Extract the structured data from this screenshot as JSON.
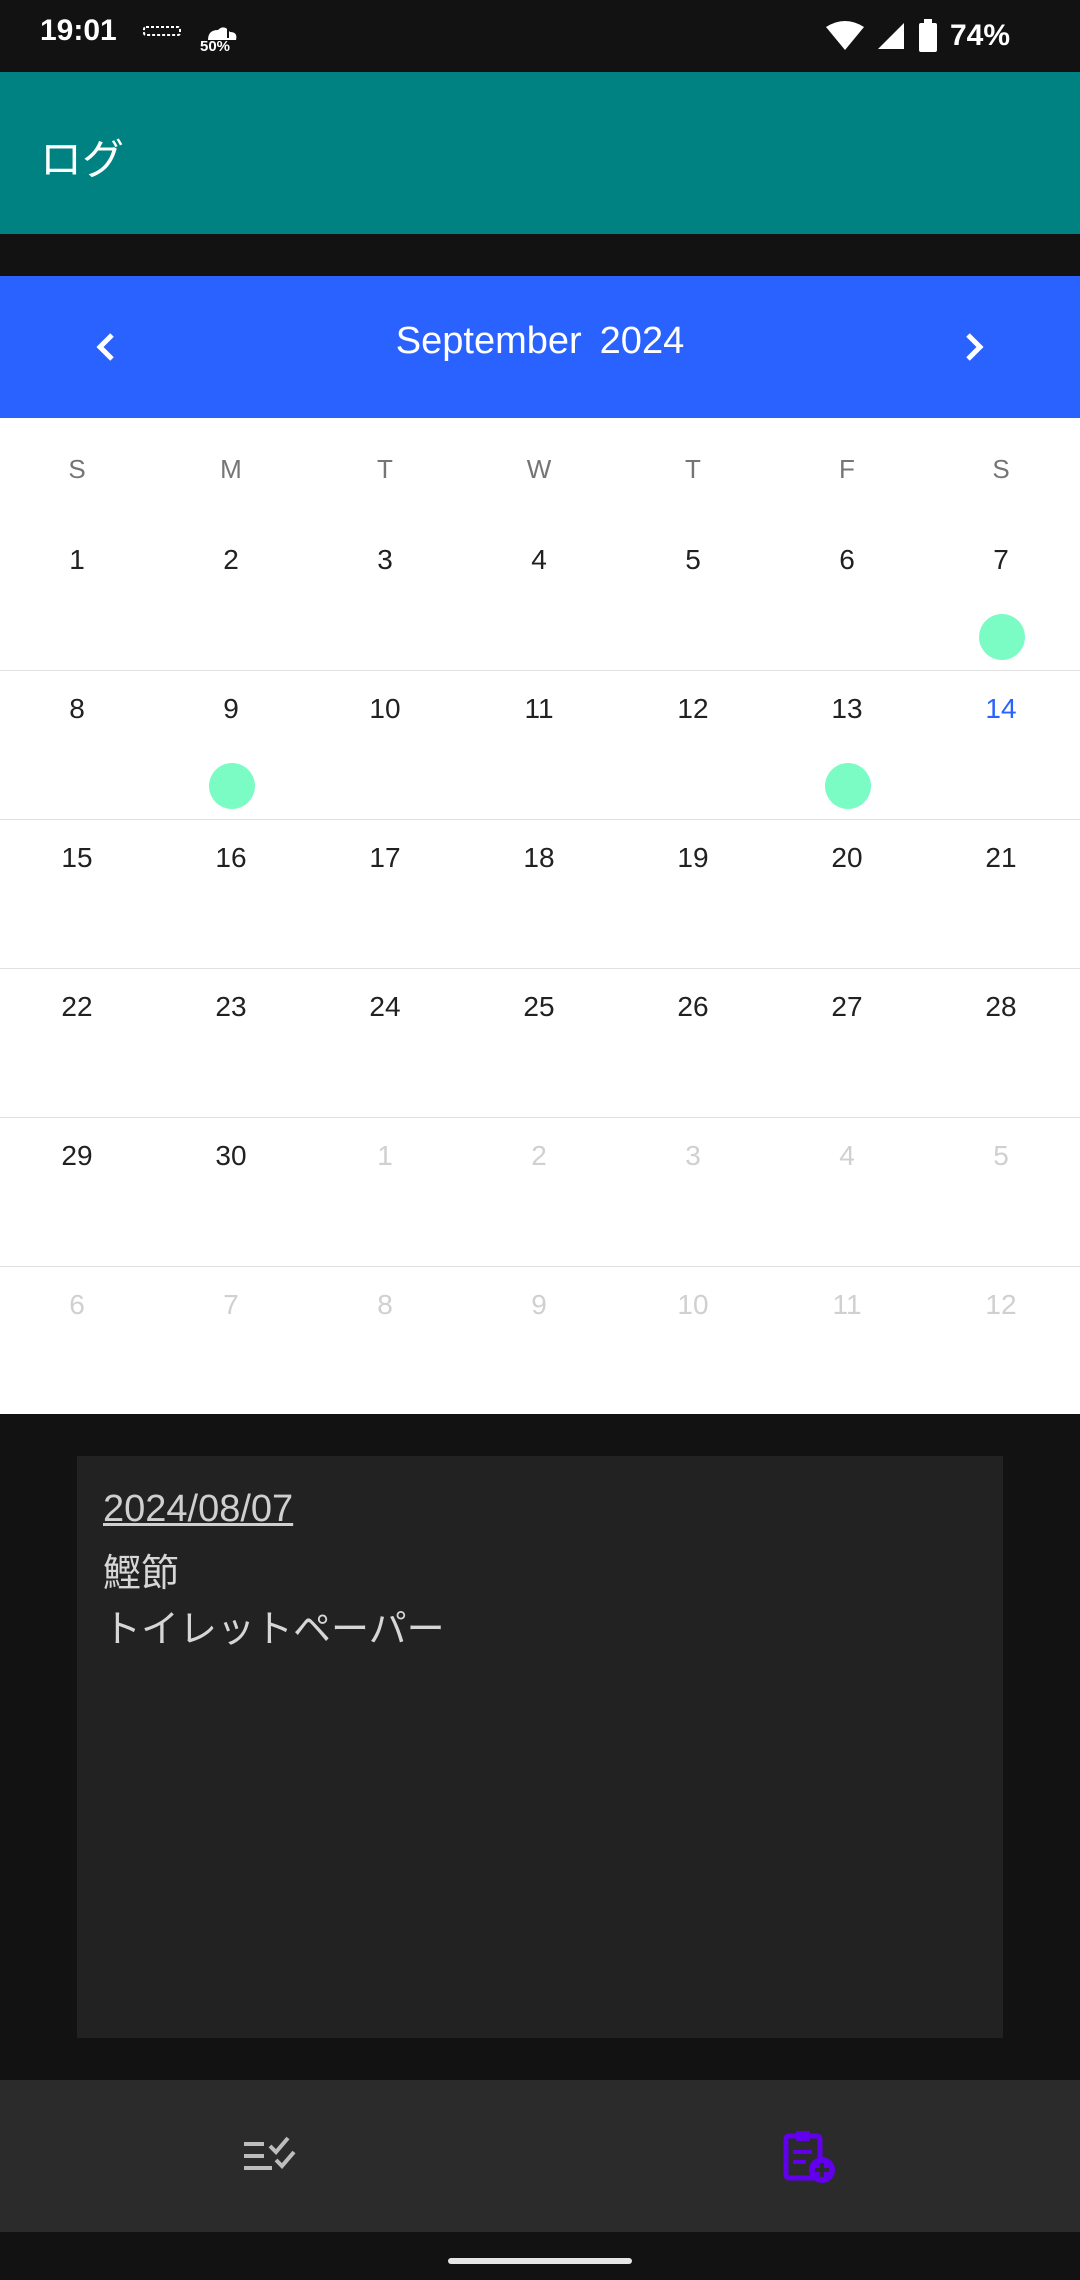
{
  "status_bar": {
    "time": "19:01",
    "weather_label": "50%",
    "battery": "74%"
  },
  "app_bar": {
    "title": "ログ"
  },
  "calendar": {
    "month": "September",
    "year": "2024",
    "weekdays": [
      "S",
      "M",
      "T",
      "W",
      "T",
      "F",
      "S"
    ],
    "weeks": [
      [
        "1",
        "2",
        "3",
        "4",
        "5",
        "6",
        "7"
      ],
      [
        "8",
        "9",
        "10",
        "11",
        "12",
        "13",
        "14"
      ],
      [
        "15",
        "16",
        "17",
        "18",
        "19",
        "20",
        "21"
      ],
      [
        "22",
        "23",
        "24",
        "25",
        "26",
        "27",
        "28"
      ],
      [
        "29",
        "30",
        "1",
        "2",
        "3",
        "4",
        "5"
      ],
      [
        "6",
        "7",
        "8",
        "9",
        "10",
        "11",
        "12"
      ]
    ],
    "today": "14",
    "marked_days": [
      "7",
      "9",
      "13"
    ],
    "dot_color": "#7CFCC5",
    "header_color": "#2962FF",
    "today_color": "#2962FF"
  },
  "note": {
    "date": "2024/08/07",
    "lines": [
      "鰹節",
      "トイレットペーパー"
    ]
  },
  "bottom_nav": {
    "items": [
      {
        "icon": "checklist-icon",
        "active": false
      },
      {
        "icon": "clipboard-add-icon",
        "active": true,
        "color": "#6200EE"
      }
    ]
  },
  "colors": {
    "app_bar": "#008282",
    "background": "#121212"
  }
}
